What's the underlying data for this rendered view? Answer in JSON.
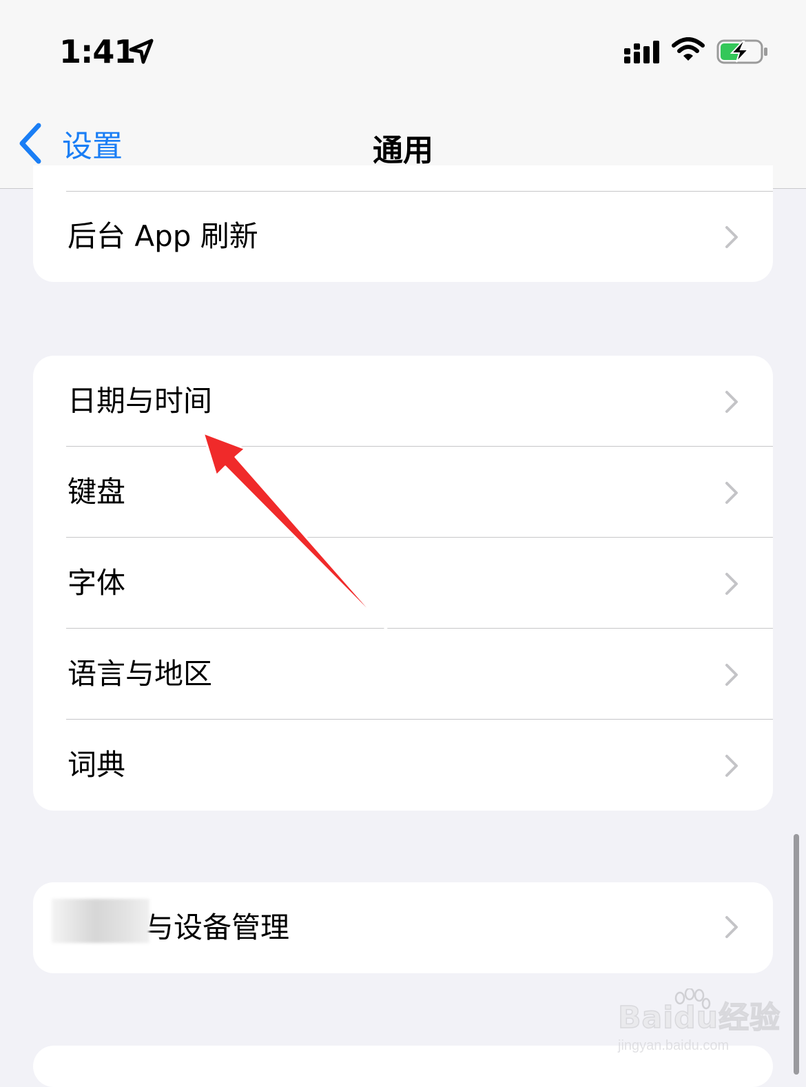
{
  "status": {
    "time": "1:41"
  },
  "nav": {
    "back_label": "设置",
    "title": "通用"
  },
  "group1": {
    "items": [
      {
        "label": "后台 App 刷新"
      }
    ]
  },
  "group2": {
    "items": [
      {
        "label": "日期与时间"
      },
      {
        "label": "键盘"
      },
      {
        "label": "字体"
      },
      {
        "label": "语言与地区"
      },
      {
        "label": "词典"
      }
    ]
  },
  "group3": {
    "items": [
      {
        "label": "与设备管理"
      }
    ]
  },
  "watermark": {
    "brand": "Baidu经验",
    "url": "jingyan.baidu.com"
  },
  "colors": {
    "accent": "#1a7ef5",
    "battery_fill": "#34c759",
    "arrow": "#f02a2a"
  }
}
